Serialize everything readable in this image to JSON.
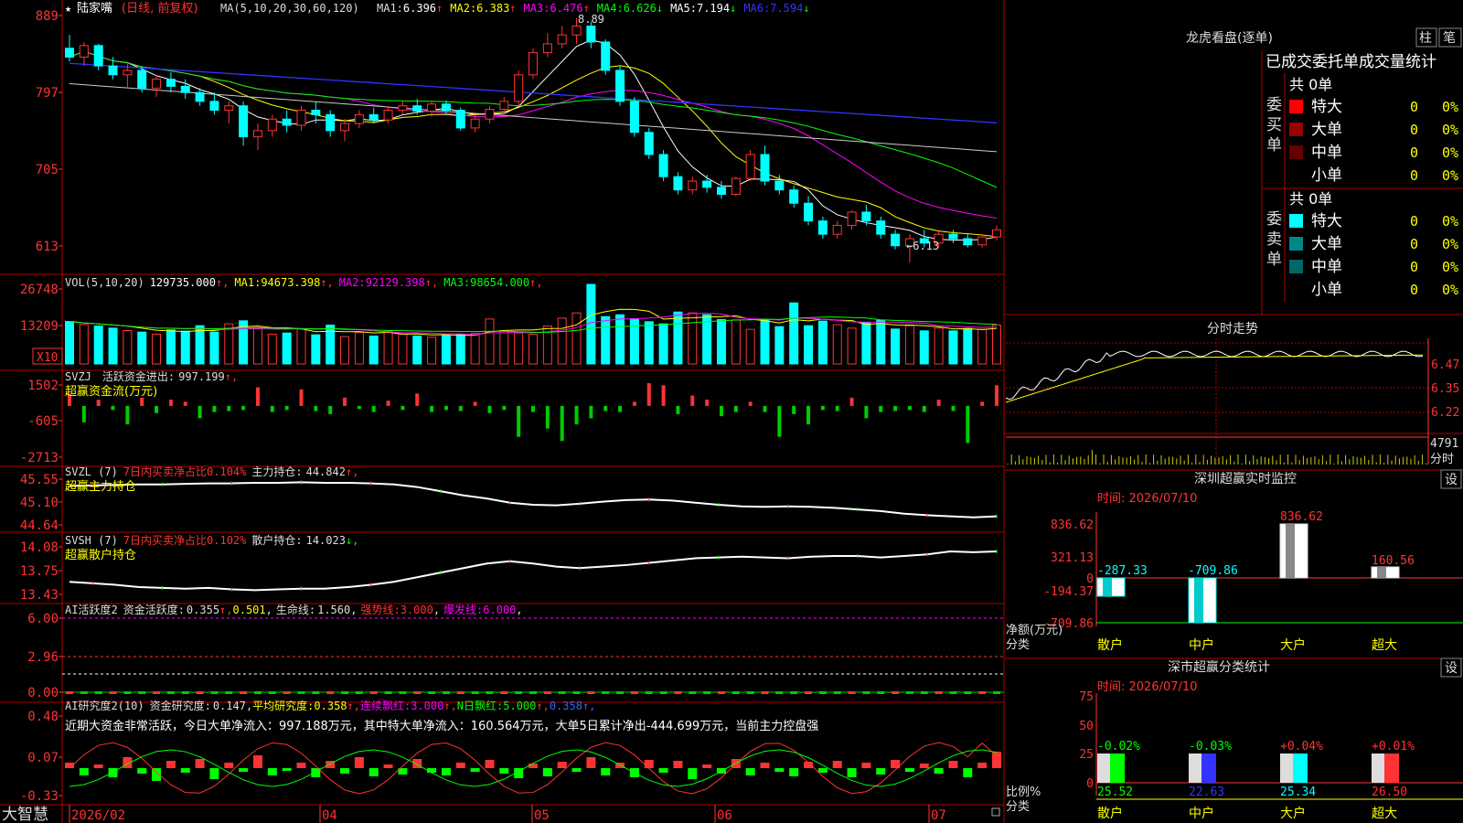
{
  "stock": {
    "name": "陆家嘴",
    "mode": "(日线, 前复权)",
    "ma_label": "MA(5,10,20,30,60,120)",
    "ma_values": [
      {
        "label": "MA1:",
        "value": "6.396",
        "arrow": "↑",
        "color": "#ffffff"
      },
      {
        "label": "MA2:",
        "value": "6.383",
        "arrow": "↑",
        "color": "#ffff00"
      },
      {
        "label": "MA3:",
        "value": "6.476",
        "arrow": "↑",
        "color": "#ff00ff"
      },
      {
        "label": "MA4:",
        "value": "6.626",
        "arrow": "↓",
        "color": "#00ff00"
      },
      {
        "label": "MA5:",
        "value": "7.194",
        "arrow": "↓",
        "color": "#ffffff"
      },
      {
        "label": "MA6:",
        "value": "7.594",
        "arrow": "↓",
        "color": "#3333ff"
      }
    ],
    "high_label": "8.89",
    "low_label": "←6.13",
    "yticks": [
      "889",
      "797",
      "705",
      "613"
    ]
  },
  "volume": {
    "header": "VOL(5,10,20)",
    "value": "129735.000",
    "ma": [
      {
        "label": "MA1:",
        "value": "94673.398",
        "color": "#ffff00"
      },
      {
        "label": "MA2:",
        "value": "92129.398",
        "color": "#ff00ff"
      },
      {
        "label": "MA3:",
        "value": "98654.000",
        "color": "#00ff00"
      }
    ],
    "yticks": [
      "26748",
      "13209"
    ],
    "unit": "X10"
  },
  "svzj": {
    "header": "SVZJ",
    "label": "活跃资金进出:",
    "value": "997.199",
    "sub": "超赢资金流(万元)",
    "yticks": [
      "1502",
      "-605",
      "-2713"
    ]
  },
  "svzl": {
    "header": "SVZL (7)",
    "ratio": "7日内买卖净占比0.104%",
    "label": "主力持仓:",
    "value": "44.842",
    "sub": "超赢主力持仓",
    "yticks": [
      "45.55",
      "45.10",
      "44.64"
    ]
  },
  "svsh": {
    "header": "SVSH (7)",
    "ratio": "7日内买卖净占比0.102%",
    "label": "散户持仓:",
    "value": "14.023",
    "sub": "超赢散户持仓",
    "yticks": [
      "14.08",
      "13.75",
      "13.43"
    ]
  },
  "ai1": {
    "header": "AI活跃度2",
    "label": "资金活跃度:",
    "v1": "0.355",
    "v2": "0.501",
    "l3": "生命线:",
    "v3": "1.560",
    "l4": "强势线:",
    "v4": "3.000",
    "l5": "爆发线:",
    "v5": "6.000",
    "yticks": [
      "6.00",
      "2.96",
      "0.00"
    ]
  },
  "ai2": {
    "header": "AI研究度2(10)",
    "label": "资金研究度:",
    "v1": "0.147",
    "l2": "平均研究度:",
    "v2": "0.358",
    "l3": "连续飘红:",
    "v3": "3.000",
    "l4": "N日飘红:",
    "v4": "5.000",
    "v5": "0.358",
    "comment": "近期大资金非常活跃，今日大单净流入：997.188万元，其中特大单净流入：160.564万元，大单5日累计净出-444.699万元，当前主力控盘强",
    "yticks": [
      "0.48",
      "0.07",
      "-0.33"
    ]
  },
  "xaxis": {
    "brand": "大智慧",
    "labels": [
      "2026/02",
      "04",
      "05",
      "06",
      "07"
    ]
  },
  "dragon": {
    "title": "龙虎看盘(逐单)",
    "btn1": "柱",
    "btn2": "笔",
    "subtitle": "已成交委托单成交量统计",
    "buy_label": "委买单",
    "sell_label": "委卖单",
    "buy_total": "共 0单",
    "sell_total": "共 0单",
    "buy_rows": [
      {
        "name": "特大",
        "count": "0",
        "pct": "0%",
        "color": "#ff0000"
      },
      {
        "name": "大单",
        "count": "0",
        "pct": "0%",
        "color": "#990000"
      },
      {
        "name": "中单",
        "count": "0",
        "pct": "0%",
        "color": "#660000"
      },
      {
        "name": "小单",
        "count": "0",
        "pct": "0%",
        "color": ""
      }
    ],
    "sell_rows": [
      {
        "name": "特大",
        "count": "0",
        "pct": "0%",
        "color": "#00ffff"
      },
      {
        "name": "大单",
        "count": "0",
        "pct": "0%",
        "color": "#008888"
      },
      {
        "name": "中单",
        "count": "0",
        "pct": "0%",
        "color": "#006666"
      },
      {
        "name": "小单",
        "count": "0",
        "pct": "0%",
        "color": ""
      }
    ]
  },
  "fenshi": {
    "title": "分时走势",
    "yticks": [
      "6.47",
      "6.35",
      "6.22"
    ],
    "vol_top": "4791",
    "vol_unit": "分时"
  },
  "szmon": {
    "title": "深圳超赢实时监控",
    "btn": "设",
    "time": "时间: 2026/07/10",
    "yticks": [
      "836.62",
      "321.13",
      "0",
      "-194.37",
      "-709.86"
    ],
    "legend1": "净额(万元)",
    "legend2": "分类",
    "cats": [
      "散户",
      "中户",
      "大户",
      "超大"
    ],
    "labels": [
      "-287.33",
      "-709.86",
      "836.62",
      "160.56"
    ]
  },
  "szstat": {
    "title": "深市超赢分类统计",
    "btn": "设",
    "time": "时间: 2026/07/10",
    "yticks": [
      "75",
      "50",
      "25",
      "0"
    ],
    "legend1": "比例%",
    "legend2": "分类",
    "cats": [
      "散户",
      "中户",
      "大户",
      "超大"
    ],
    "changes": [
      "-0.02%",
      "-0.03%",
      "+0.04%",
      "+0.01%"
    ],
    "pcts": [
      "25.52",
      "22.63",
      "25.34",
      "26.50"
    ]
  },
  "chart_data": [
    {
      "type": "candlestick",
      "title": "陆家嘴 (日线, 前复权)",
      "note": "sampled daily bars; values in 元 (axis labels 889/797/705/613 = ×100)",
      "ylim": [
        6.08,
        8.95
      ],
      "x_labels": [
        "2026/02",
        "04",
        "05",
        "06",
        "07"
      ],
      "ohlc": [
        [
          8.55,
          8.7,
          8.4,
          8.45
        ],
        [
          8.45,
          8.62,
          8.35,
          8.58
        ],
        [
          8.58,
          8.6,
          8.3,
          8.35
        ],
        [
          8.35,
          8.45,
          8.2,
          8.25
        ],
        [
          8.25,
          8.4,
          8.1,
          8.3
        ],
        [
          8.3,
          8.35,
          8.05,
          8.1
        ],
        [
          8.1,
          8.25,
          8.0,
          8.2
        ],
        [
          8.2,
          8.28,
          8.05,
          8.12
        ],
        [
          8.12,
          8.2,
          7.98,
          8.05
        ],
        [
          8.05,
          8.1,
          7.9,
          7.95
        ],
        [
          7.95,
          8.05,
          7.8,
          7.85
        ],
        [
          7.85,
          7.95,
          7.7,
          7.9
        ],
        [
          7.9,
          7.95,
          7.45,
          7.55
        ],
        [
          7.55,
          7.7,
          7.4,
          7.62
        ],
        [
          7.62,
          7.8,
          7.55,
          7.75
        ],
        [
          7.75,
          7.85,
          7.6,
          7.68
        ],
        [
          7.68,
          7.9,
          7.62,
          7.85
        ],
        [
          7.85,
          7.95,
          7.7,
          7.8
        ],
        [
          7.8,
          7.85,
          7.55,
          7.62
        ],
        [
          7.62,
          7.75,
          7.5,
          7.7
        ],
        [
          7.7,
          7.85,
          7.65,
          7.8
        ],
        [
          7.8,
          7.88,
          7.7,
          7.74
        ],
        [
          7.74,
          7.9,
          7.7,
          7.85
        ],
        [
          7.85,
          7.95,
          7.8,
          7.9
        ],
        [
          7.9,
          7.98,
          7.8,
          7.84
        ],
        [
          7.84,
          7.95,
          7.78,
          7.92
        ],
        [
          7.92,
          7.96,
          7.8,
          7.85
        ],
        [
          7.85,
          7.88,
          7.62,
          7.65
        ],
        [
          7.65,
          7.8,
          7.6,
          7.75
        ],
        [
          7.75,
          7.9,
          7.7,
          7.86
        ],
        [
          7.86,
          8.0,
          7.8,
          7.95
        ],
        [
          7.95,
          8.3,
          7.9,
          8.25
        ],
        [
          8.25,
          8.55,
          8.2,
          8.5
        ],
        [
          8.5,
          8.72,
          8.45,
          8.6
        ],
        [
          8.6,
          8.8,
          8.55,
          8.7
        ],
        [
          8.7,
          8.89,
          8.6,
          8.8
        ],
        [
          8.8,
          8.85,
          8.55,
          8.62
        ],
        [
          8.62,
          8.65,
          8.25,
          8.3
        ],
        [
          8.3,
          8.35,
          7.9,
          7.95
        ],
        [
          7.95,
          8.0,
          7.55,
          7.6
        ],
        [
          7.6,
          7.65,
          7.3,
          7.35
        ],
        [
          7.35,
          7.4,
          7.05,
          7.1
        ],
        [
          7.1,
          7.15,
          6.9,
          6.95
        ],
        [
          6.95,
          7.1,
          6.9,
          7.05
        ],
        [
          7.05,
          7.12,
          6.92,
          6.98
        ],
        [
          6.98,
          7.05,
          6.85,
          6.9
        ],
        [
          6.9,
          7.1,
          6.88,
          7.08
        ],
        [
          7.08,
          7.4,
          7.05,
          7.35
        ],
        [
          7.35,
          7.45,
          7.0,
          7.05
        ],
        [
          7.05,
          7.12,
          6.9,
          6.95
        ],
        [
          6.95,
          7.0,
          6.75,
          6.8
        ],
        [
          6.8,
          6.88,
          6.55,
          6.6
        ],
        [
          6.6,
          6.65,
          6.4,
          6.45
        ],
        [
          6.45,
          6.6,
          6.4,
          6.55
        ],
        [
          6.55,
          6.72,
          6.5,
          6.7
        ],
        [
          6.7,
          6.78,
          6.55,
          6.6
        ],
        [
          6.6,
          6.65,
          6.4,
          6.45
        ],
        [
          6.45,
          6.5,
          6.28,
          6.32
        ],
        [
          6.32,
          6.45,
          6.13,
          6.4
        ],
        [
          6.4,
          6.5,
          6.3,
          6.35
        ],
        [
          6.35,
          6.48,
          6.3,
          6.45
        ],
        [
          6.45,
          6.5,
          6.35,
          6.4
        ],
        [
          6.4,
          6.45,
          6.3,
          6.33
        ],
        [
          6.33,
          6.45,
          6.3,
          6.42
        ],
        [
          6.42,
          6.55,
          6.38,
          6.5
        ]
      ]
    },
    {
      "type": "bar",
      "title": "VOL(5,10,20)",
      "unit": "X10",
      "ylim": [
        0,
        28000
      ],
      "values": [
        14000,
        13000,
        12500,
        11800,
        11000,
        10500,
        9800,
        11200,
        10800,
        12600,
        10500,
        13200,
        14200,
        12000,
        9800,
        10200,
        11500,
        9600,
        12800,
        9000,
        10400,
        9200,
        10800,
        9800,
        9200,
        8800,
        9500,
        9700,
        10100,
        14800,
        11000,
        10200,
        9800,
        12500,
        15100,
        16800,
        26200,
        15600,
        16200,
        14900,
        13900,
        13200,
        17100,
        16800,
        16200,
        14600,
        14500,
        11400,
        14600,
        12300,
        20100,
        12600,
        14100,
        12900,
        11800,
        13600,
        14400,
        11500,
        12600,
        10900,
        11800,
        10900,
        11700,
        11400,
        12800
      ]
    },
    {
      "type": "bar",
      "title": "SVZJ 超赢资金流(万元)",
      "ylim": [
        -2713,
        1502
      ],
      "values": [
        600,
        -800,
        300,
        -200,
        -900,
        400,
        -350,
        300,
        200,
        -600,
        -300,
        -250,
        -200,
        900,
        -300,
        -200,
        800,
        -250,
        -400,
        400,
        -150,
        -300,
        250,
        -200,
        600,
        -300,
        -200,
        -250,
        200,
        -350,
        -200,
        -1500,
        -300,
        -1100,
        -1700,
        -900,
        -600,
        -250,
        -300,
        200,
        1100,
        1000,
        -400,
        500,
        300,
        -500,
        -300,
        200,
        -300,
        -1500,
        -400,
        -900,
        -200,
        -250,
        400,
        -600,
        -300,
        -250,
        -200,
        -300,
        300,
        -250,
        -1800,
        200,
        997
      ]
    },
    {
      "type": "line",
      "title": "SVZL 超赢主力持仓",
      "ylim": [
        44.64,
        45.55
      ],
      "values": [
        45.42,
        45.43,
        45.44,
        45.45,
        45.45,
        45.46,
        45.47,
        45.47,
        45.48,
        45.48,
        45.49,
        45.48,
        45.48,
        45.47,
        45.45,
        45.4,
        45.32,
        45.24,
        45.18,
        45.1,
        45.06,
        45.05,
        45.08,
        45.12,
        45.15,
        45.16,
        45.14,
        45.1,
        45.06,
        45.03,
        45.02,
        45.03,
        45.02,
        45.0,
        44.97,
        44.94,
        44.89,
        44.86,
        44.84,
        44.82,
        44.84
      ]
    },
    {
      "type": "line",
      "title": "SVSH 超赢散户持仓",
      "ylim": [
        13.43,
        14.08
      ],
      "values": [
        13.62,
        13.6,
        13.58,
        13.55,
        13.54,
        13.53,
        13.54,
        13.52,
        13.51,
        13.52,
        13.53,
        13.53,
        13.55,
        13.58,
        13.62,
        13.68,
        13.74,
        13.8,
        13.86,
        13.89,
        13.86,
        13.82,
        13.8,
        13.82,
        13.84,
        13.87,
        13.9,
        13.93,
        13.94,
        13.95,
        13.94,
        13.93,
        13.95,
        13.96,
        13.96,
        13.94,
        13.96,
        13.98,
        14.02,
        14.01,
        14.02
      ]
    }
  ]
}
